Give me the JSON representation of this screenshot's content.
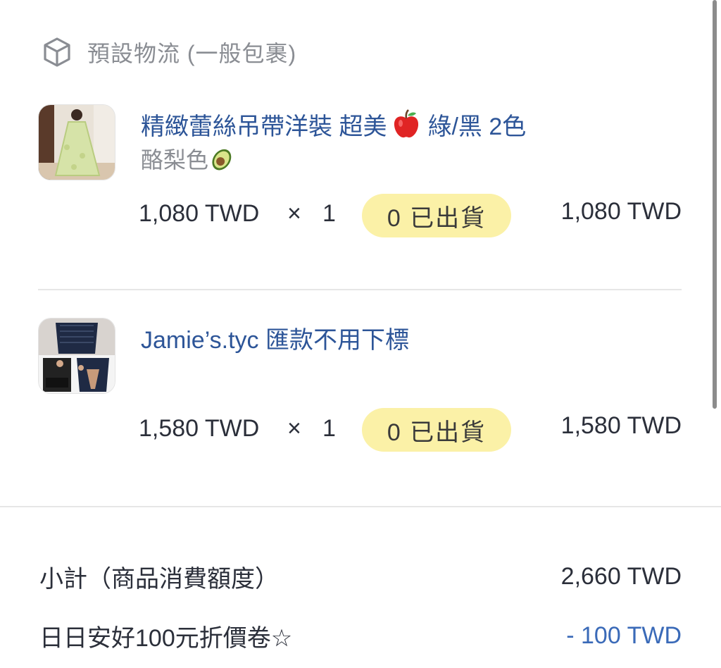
{
  "shipping": {
    "label": "預設物流 (一般包裹)",
    "icon": "package-icon"
  },
  "items": [
    {
      "title": "精緻蕾絲吊帶洋裝 超美",
      "title_emoji": "apple-emoji",
      "title_suffix": "綠/黑 2色",
      "variant": "酪梨色",
      "variant_emoji": "avocado-emoji",
      "unit_price": "1,080 TWD",
      "times": "×",
      "quantity": "1",
      "shipped_badge": "0 已出貨",
      "total": "1,080 TWD"
    },
    {
      "title": "Jamie’s.tyc 匯款不用下標",
      "unit_price": "1,580 TWD",
      "times": "×",
      "quantity": "1",
      "shipped_badge": "0 已出貨",
      "total": "1,580 TWD"
    }
  ],
  "summary": {
    "subtotal_label": "小計（商品消費額度）",
    "subtotal_value": "2,660 TWD",
    "discount_label": "日日安好100元折價卷☆",
    "discount_value": "- 100 TWD"
  },
  "colors": {
    "link_blue": "#2d5598",
    "badge_yellow": "#fbf1a7",
    "discount_blue": "#3a6ab8",
    "muted_gray": "#8a8d93"
  }
}
